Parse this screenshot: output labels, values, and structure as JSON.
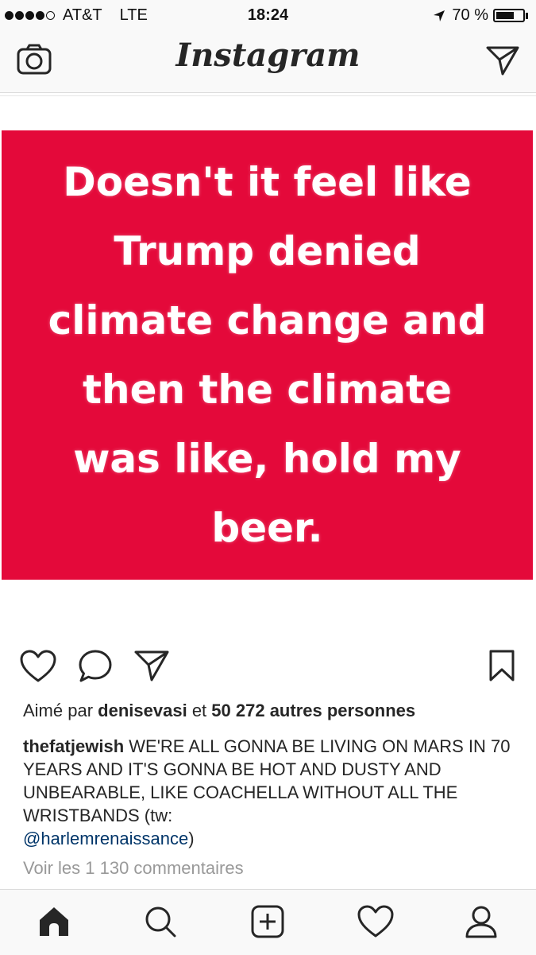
{
  "status_bar": {
    "carrier": "AT&T",
    "network": "LTE",
    "time": "18:24",
    "battery_percent": "70 %",
    "battery_level": 0.7,
    "signal_bars_filled": 4,
    "signal_bars_total": 5
  },
  "nav": {
    "title": "Instagram",
    "left_icon": "camera-icon",
    "right_icon": "direct-send-icon"
  },
  "post": {
    "image_text": "Doesn't it feel like\nTrump denied\nclimate change and\nthen the climate\nwas like, hold my\nbeer.",
    "image_bg_color": "#e4093a",
    "likes_prefix": "Aimé par",
    "likes_user": "denisevasi",
    "likes_connector": "et",
    "likes_count_text": "50 272 autres personnes",
    "caption_user": "thefatjewish",
    "caption_text": "WE'RE ALL GONNA BE LIVING ON MARS IN 70 YEARS AND IT'S GONNA BE HOT AND DUSTY AND UNBEARABLE, LIKE COACHELLA WITHOUT ALL THE WRISTBANDS (tw:",
    "caption_mention": "@harlemrenaissance",
    "caption_end": ")",
    "comments_link": "Voir les 1 130 commentaires"
  },
  "actions": [
    "heart-icon",
    "comment-icon",
    "share-icon",
    "bookmark-icon"
  ],
  "tabbar": [
    "home-icon",
    "search-icon",
    "add-post-icon",
    "activity-heart-icon",
    "profile-icon"
  ],
  "colors": {
    "mention": "#003569",
    "muted": "#999999",
    "text": "#262626"
  }
}
